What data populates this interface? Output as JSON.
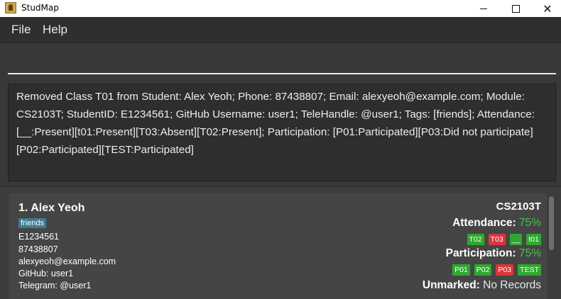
{
  "window": {
    "title": "StudMap",
    "icon": "studmap-app-icon"
  },
  "menu": {
    "file": "File",
    "help": "Help"
  },
  "command": {
    "value": "",
    "placeholder": ""
  },
  "result": {
    "message": "Removed Class T01 from Student: Alex Yeoh; Phone: 87438807; Email: alexyeoh@example.com; Module: CS2103T; StudentID: E1234561; GitHub Username: user1; TeleHandle: @user1; Tags: [friends]; Attendance: [__:Present][t01:Present][T03:Absent][T02:Present]; Participation: [P01:Participated][P03:Did not participate][P02:Participated][TEST:Participated]"
  },
  "students": [
    {
      "index_name": "1.  Alex Yeoh",
      "tag": "friends",
      "student_id": "E1234561",
      "phone": "87438807",
      "email": "alexyeoh@example.com",
      "github": "GitHub: user1",
      "telegram": "Telegram: @user1",
      "module": "CS2103T",
      "attendance_label": "Attendance:",
      "attendance_value": "75%",
      "attendance_badges": [
        {
          "label": "T02",
          "status": "present"
        },
        {
          "label": "T03",
          "status": "absent"
        },
        {
          "label": "__",
          "status": "present"
        },
        {
          "label": "t01",
          "status": "present"
        }
      ],
      "participation_label": "Participation:",
      "participation_value": "75%",
      "participation_badges": [
        {
          "label": "P01",
          "status": "participated"
        },
        {
          "label": "P02",
          "status": "participated"
        },
        {
          "label": "P03",
          "status": "not-participated"
        },
        {
          "label": "TEST",
          "status": "participated"
        }
      ],
      "unmarked_label": "Unmarked:",
      "unmarked_value": "No Records"
    }
  ],
  "colors": {
    "present": "#2ea82e",
    "absent": "#d9363b",
    "percentage": "#4cc04c",
    "tag": "#3e7b91"
  }
}
